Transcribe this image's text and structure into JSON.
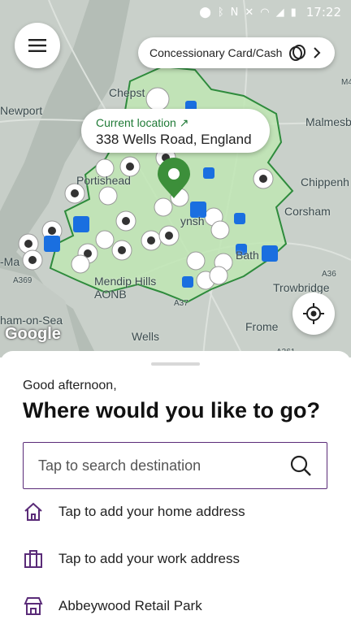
{
  "status_bar": {
    "icons": [
      "location-icon",
      "bluetooth-icon",
      "nfc-icon",
      "mute-icon",
      "wifi-icon",
      "signal-icon",
      "battery-icon"
    ],
    "time": "17:22"
  },
  "map": {
    "places": [
      {
        "name": "Newport"
      },
      {
        "name": "Chepst"
      },
      {
        "name": "Malmesb"
      },
      {
        "name": "Portishead"
      },
      {
        "name": "Chippenh"
      },
      {
        "name": "Corsham"
      },
      {
        "name": "ynsh"
      },
      {
        "name": "Bath"
      },
      {
        "name": "Trowbridge"
      },
      {
        "name": "Frome"
      },
      {
        "name": "Wells"
      },
      {
        "name": "Mendip Hills AONB"
      },
      {
        "name": "ham-on-Sea"
      },
      {
        "name": "-Ma"
      },
      {
        "name": "A369"
      },
      {
        "name": "A36"
      },
      {
        "name": "A361"
      },
      {
        "name": "M4"
      },
      {
        "name": "A37"
      }
    ],
    "attribution": "Google",
    "zone_color": "#bfe6b4",
    "zone_border_color": "#2e8b3c"
  },
  "header": {
    "menu_icon": "hamburger-menu-icon",
    "payment_label": "Concessionary Card/Cash",
    "payment_icon": "contactless-card-icon",
    "chevron_icon": "chevron-right-icon"
  },
  "location_card": {
    "label": "Current location ↗",
    "address": "338 Wells Road, England"
  },
  "sheet": {
    "greeting": "Good afternoon,",
    "heading": "Where would you like to go?",
    "search_placeholder": "Tap to search destination",
    "rows": [
      {
        "icon": "home-icon",
        "label": "Tap to add your home address"
      },
      {
        "icon": "briefcase-icon",
        "label": "Tap to add your work address"
      },
      {
        "icon": "store-icon",
        "label": "Abbeywood Retail Park"
      }
    ]
  },
  "colors": {
    "accent": "#5a2b78",
    "location_green": "#1f7a36",
    "pin_green": "#3c8f3a",
    "metro_blue": "#1a6fe0"
  }
}
